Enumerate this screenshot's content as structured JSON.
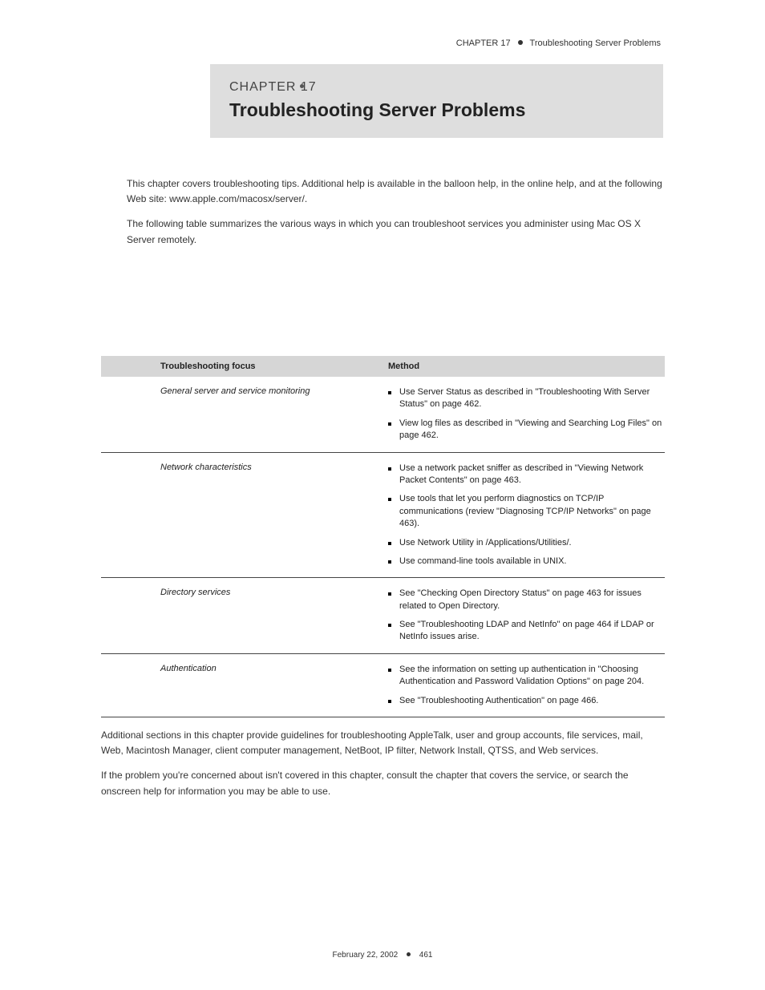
{
  "header": {
    "kicker": "CHAPTER 17",
    "short_title": "Troubleshooting Server Problems"
  },
  "titlebar": {
    "kicker": "CHAPTER 17",
    "title": "Troubleshooting Server Problems"
  },
  "lead": {
    "p1": "This chapter covers troubleshooting tips. Additional help is available in the balloon help, in the online help, and at the following Web site: www.apple.com/macosx/server/.",
    "p2": "The following table summarizes the various ways in which you can troubleshoot services you administer using Mac OS X Server remotely."
  },
  "table": {
    "head": {
      "col1": "Troubleshooting focus",
      "col2": "Method"
    },
    "rows": [
      {
        "focus": "General server and service monitoring",
        "methods": [
          "Use Server Status as described in \"Troubleshooting With Server Status\" on page 462.",
          "View log files as described in \"Viewing and Searching Log Files\" on page 462."
        ]
      },
      {
        "focus": "Network characteristics",
        "methods": [
          "Use a network packet sniffer as described in \"Viewing Network Packet Contents\" on page 463.",
          "Use tools that let you perform diagnostics on TCP/IP communications (review \"Diagnosing TCP/IP Networks\" on page 463).",
          "Use Network Utility in /Applications/Utilities/.",
          "Use command-line tools available in UNIX."
        ]
      },
      {
        "focus": "Directory services",
        "methods": [
          "See \"Checking Open Directory Status\" on page 463 for issues related to Open Directory.",
          "See \"Troubleshooting LDAP and NetInfo\" on page 464 if LDAP or NetInfo issues arise."
        ]
      },
      {
        "focus": "Authentication",
        "methods": [
          "See the information on setting up authentication in \"Choosing Authentication and Password Validation Options\" on page 204.",
          "See \"Troubleshooting Authentication\" on page 466."
        ]
      }
    ]
  },
  "continued": {
    "p1": "Additional sections in this chapter provide guidelines for troubleshooting AppleTalk, user and group accounts, file services, mail, Web, Macintosh Manager, client computer management, NetBoot, IP filter, Network Install, QTSS, and Web services.",
    "p2": "If the problem you're concerned about isn't covered in this chapter, consult the chapter that covers the service, or search the onscreen help for information you may be able to use."
  },
  "footer": {
    "left": "February 22, 2002",
    "page": "461"
  }
}
